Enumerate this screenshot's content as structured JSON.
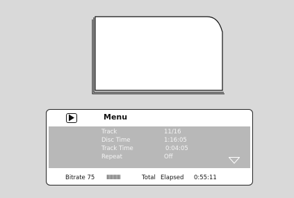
{
  "osd": {
    "menu_title": "Menu",
    "info_rows": [
      {
        "label": "Track",
        "value": "11/16"
      },
      {
        "label": "Disc Time",
        "value": "1:16:05"
      },
      {
        "label": "Track Time",
        "value": "0:04:05"
      },
      {
        "label": "Repeat",
        "value": "Off"
      }
    ],
    "footer": {
      "bitrate_label": "Bitrate 75",
      "bitrate_meter": "IIIIIIIIII",
      "total_label": "Total",
      "elapsed_label": "Elapsed",
      "elapsed_value": "0:55:11"
    }
  },
  "icons": {
    "play": "play-icon",
    "scroll_down": "triangle-down-icon"
  },
  "colors": {
    "background": "#d9d9d9",
    "panel_body": "#b8b8b8",
    "panel_text": "#f4f4f4",
    "border": "#222222"
  }
}
